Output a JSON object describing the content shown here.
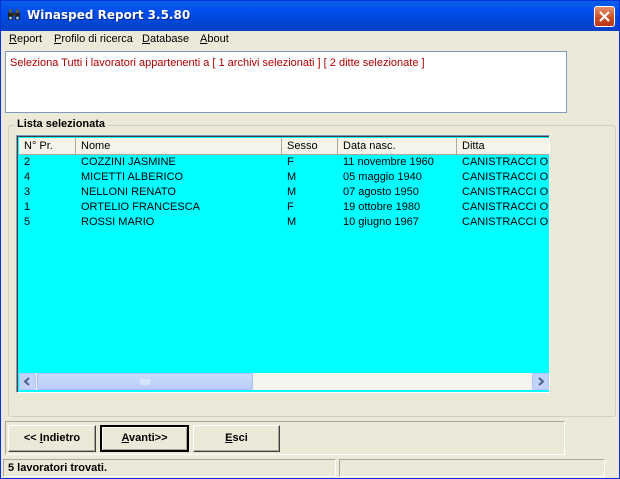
{
  "window": {
    "title": "Winasped Report 3.5.80"
  },
  "menu": [
    {
      "label": "Report",
      "accel": "R",
      "rest": "eport"
    },
    {
      "label": "Profilo di ricerca",
      "accel": "P",
      "rest": "rofilo di ricerca"
    },
    {
      "label": "Database",
      "accel": "D",
      "rest": "atabase"
    },
    {
      "label": "About",
      "accel": "A",
      "rest": "bout"
    }
  ],
  "message": {
    "text": "Seleziona Tutti i lavoratori appartenenti a  [ 1 archivi selezionati ] [ 2 ditte selezionate ]"
  },
  "list": {
    "group_label": "Lista selezionata",
    "columns": [
      "N° Pr.",
      "Nome",
      "Sesso",
      "Data nasc.",
      "Ditta"
    ],
    "rows": [
      [
        "2",
        "COZZINI JASMINE",
        "F",
        "11 novembre 1960",
        "CANISTRACCI OIL"
      ],
      [
        "4",
        "MICETTI ALBERICO",
        "M",
        "05 maggio 1940",
        "CANISTRACCI OIL"
      ],
      [
        "3",
        "NELLONI RENATO",
        "M",
        "07 agosto 1950",
        "CANISTRACCI OIL"
      ],
      [
        "1",
        "ORTELIO FRANCESCA",
        "F",
        "19 ottobre 1980",
        "CANISTRACCI OIL"
      ],
      [
        "5",
        "ROSSI MARIO",
        "M",
        "10 giugno 1967",
        "CANISTRACCI OIL"
      ]
    ],
    "background_color": "#00ffff"
  },
  "buttons": {
    "back": {
      "pre": "<< ",
      "accel": "I",
      "rest": "ndietro"
    },
    "next": {
      "pre": "",
      "accel": "A",
      "rest": "vanti>>"
    },
    "exit": {
      "pre": "",
      "accel": "E",
      "rest": "sci"
    }
  },
  "status": {
    "text": "5 lavoratori trovati.",
    "secondary": ""
  },
  "colors": {
    "titlebar": "#0050ee",
    "message_text": "#b00000",
    "list_bg": "#00ffff"
  },
  "icons": {
    "app": "binoculars-icon",
    "close": "close-icon",
    "scroll_left": "arrow-left-icon",
    "scroll_right": "arrow-right-icon"
  }
}
